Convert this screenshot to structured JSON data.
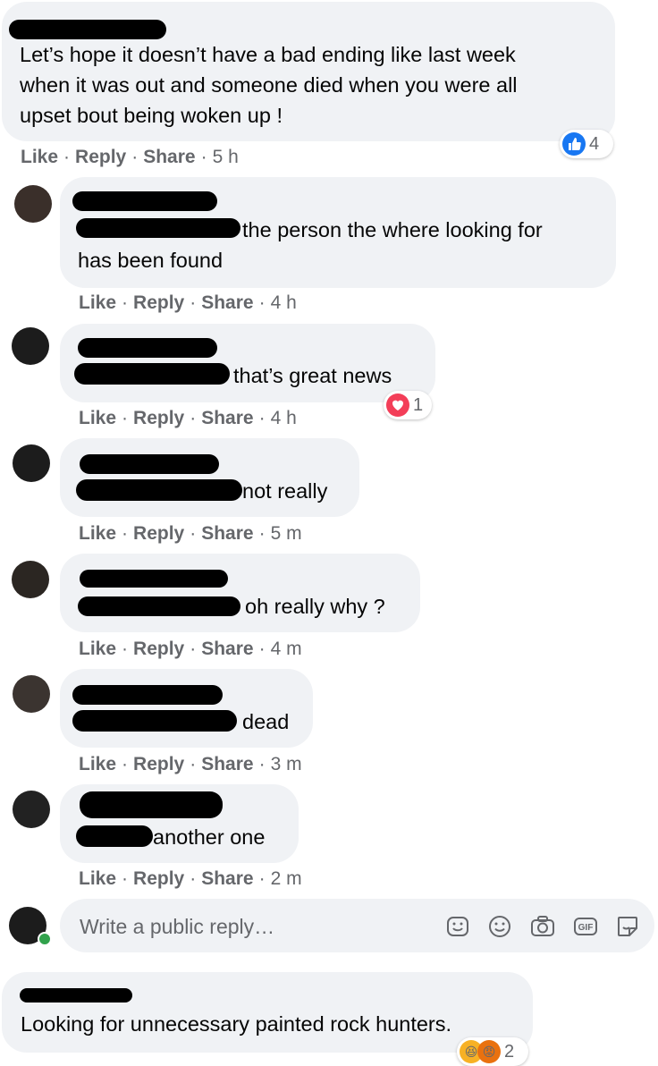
{
  "comments": [
    {
      "text_lines": [
        "Let’s hope it doesn’t have a bad ending like last week",
        "when it was out and someone died when you were all",
        "upset bout being woken up !"
      ],
      "actions": {
        "like": "Like",
        "reply": "Reply",
        "share": "Share",
        "time": "5 h"
      },
      "reaction": {
        "type": "like",
        "count": "4"
      }
    },
    {
      "text_lines": [
        "the person the where looking for",
        "has been found"
      ],
      "actions": {
        "like": "Like",
        "reply": "Reply",
        "share": "Share",
        "time": "4 h"
      }
    },
    {
      "text_lines": [
        "that’s great news"
      ],
      "actions": {
        "like": "Like",
        "reply": "Reply",
        "share": "Share",
        "time": "4 h"
      },
      "reaction": {
        "type": "love",
        "count": "1"
      }
    },
    {
      "text_lines": [
        "not really"
      ],
      "actions": {
        "like": "Like",
        "reply": "Reply",
        "share": "Share",
        "time": "5 m"
      }
    },
    {
      "text_lines": [
        "oh really why ?"
      ],
      "actions": {
        "like": "Like",
        "reply": "Reply",
        "share": "Share",
        "time": "4 m"
      }
    },
    {
      "text_lines": [
        "dead"
      ],
      "actions": {
        "like": "Like",
        "reply": "Reply",
        "share": "Share",
        "time": "3 m"
      }
    },
    {
      "text_lines": [
        "another one"
      ],
      "actions": {
        "like": "Like",
        "reply": "Reply",
        "share": "Share",
        "time": "2 m"
      }
    },
    {
      "text_lines": [
        "Looking for unnecessary painted rock hunters."
      ],
      "reaction": {
        "type": "haha-angry",
        "count": "2"
      }
    }
  ],
  "reply_box": {
    "placeholder": "Write a public reply…",
    "icons": [
      "emoji-sticker-icon",
      "smiley-icon",
      "camera-icon",
      "gif-icon",
      "sticker-icon"
    ]
  },
  "colors": {
    "bubble": "#f0f2f5",
    "meta": "#65676b",
    "like_blue": "#1877f2",
    "love_red": "#f33e58",
    "online_green": "#31a24c"
  }
}
